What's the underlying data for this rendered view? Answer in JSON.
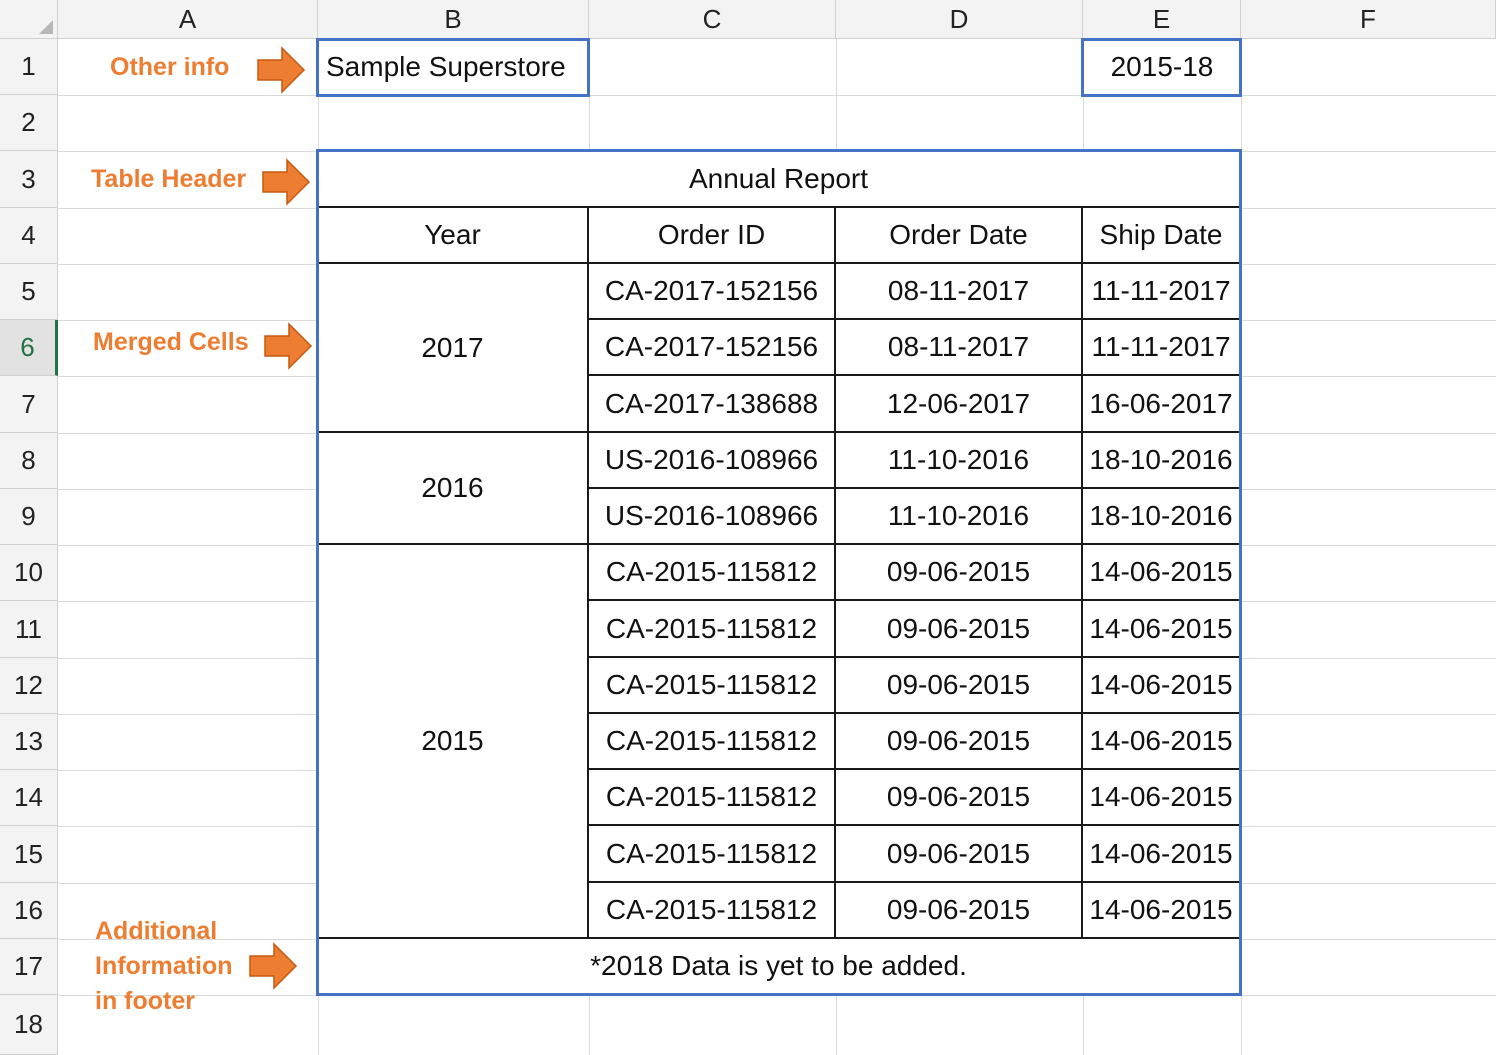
{
  "columns": [
    "A",
    "B",
    "C",
    "D",
    "E",
    "F"
  ],
  "rows": [
    "1",
    "2",
    "3",
    "4",
    "5",
    "6",
    "7",
    "8",
    "9",
    "10",
    "11",
    "12",
    "13",
    "14",
    "15",
    "16",
    "17",
    "18"
  ],
  "selected_row": "6",
  "colors": {
    "accent_blue": "#4472c4",
    "annotation_orange": "#ed7d31",
    "selected_green": "#217346"
  },
  "cells": {
    "B1": "Sample Superstore",
    "E1": "2015-18"
  },
  "table": {
    "title": "Annual Report",
    "headers": [
      "Year",
      "Order ID",
      "Order Date",
      "Ship Date"
    ],
    "year_groups": [
      "2017",
      "2016",
      "2015"
    ],
    "records": [
      [
        "CA-2017-152156",
        "08-11-2017",
        "11-11-2017"
      ],
      [
        "CA-2017-152156",
        "08-11-2017",
        "11-11-2017"
      ],
      [
        "CA-2017-138688",
        "12-06-2017",
        "16-06-2017"
      ],
      [
        "US-2016-108966",
        "11-10-2016",
        "18-10-2016"
      ],
      [
        "US-2016-108966",
        "11-10-2016",
        "18-10-2016"
      ],
      [
        "CA-2015-115812",
        "09-06-2015",
        "14-06-2015"
      ],
      [
        "CA-2015-115812",
        "09-06-2015",
        "14-06-2015"
      ],
      [
        "CA-2015-115812",
        "09-06-2015",
        "14-06-2015"
      ],
      [
        "CA-2015-115812",
        "09-06-2015",
        "14-06-2015"
      ],
      [
        "CA-2015-115812",
        "09-06-2015",
        "14-06-2015"
      ],
      [
        "CA-2015-115812",
        "09-06-2015",
        "14-06-2015"
      ],
      [
        "CA-2015-115812",
        "09-06-2015",
        "14-06-2015"
      ]
    ],
    "footer": "*2018 Data is yet to be added."
  },
  "annotations": {
    "other_info": "Other info",
    "table_header": "Table Header",
    "merged_cells": "Merged Cells",
    "footer_line1": "Additional",
    "footer_line2": "Information",
    "footer_line3": "in footer"
  },
  "icons": {
    "annotation_arrow": "right-arrow-icon"
  }
}
